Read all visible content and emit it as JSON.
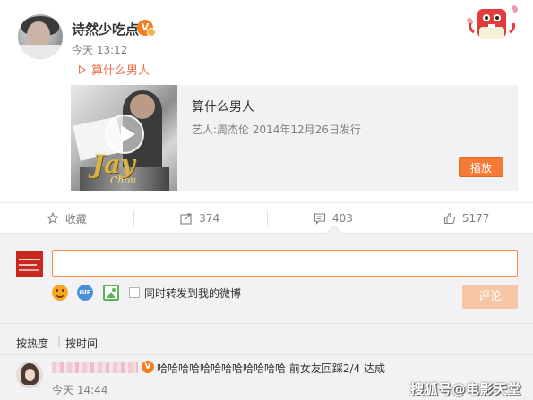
{
  "post": {
    "username": "诗然少吃点",
    "time": "今天 13:12",
    "song_link": "算什么男人"
  },
  "music_card": {
    "title": "算什么男人",
    "meta": "艺人:周杰伦 2014年12月26日发行",
    "play_label": "播放",
    "cover_lettering": "Jay Chou"
  },
  "actions": {
    "favorite_label": "收藏",
    "repost_count": "374",
    "comment_count": "403",
    "like_count": "5177"
  },
  "composer": {
    "input_value": "",
    "repost_checkbox_label": "同时转发到我的微博",
    "repost_checked": false,
    "submit_label": "评论"
  },
  "sort": {
    "hot_label": "按热度",
    "separator": "|",
    "time_label": "按时间"
  },
  "comments": [
    {
      "text": "哈哈哈哈哈哈哈哈哈哈哈哈 前女友回踩2/4  达成",
      "time": "今天 14:44"
    }
  ],
  "watermark": "搜狐号@电影天堂",
  "colors": {
    "accent": "#eb7350",
    "play_button": "#f47a35",
    "panel_bg": "#f2f2f5"
  },
  "icons": [
    "verified-badge-icon",
    "play-triangle-icon",
    "star-icon",
    "repost-icon",
    "comment-icon",
    "like-icon",
    "emoji-icon",
    "gif-icon",
    "image-icon"
  ]
}
